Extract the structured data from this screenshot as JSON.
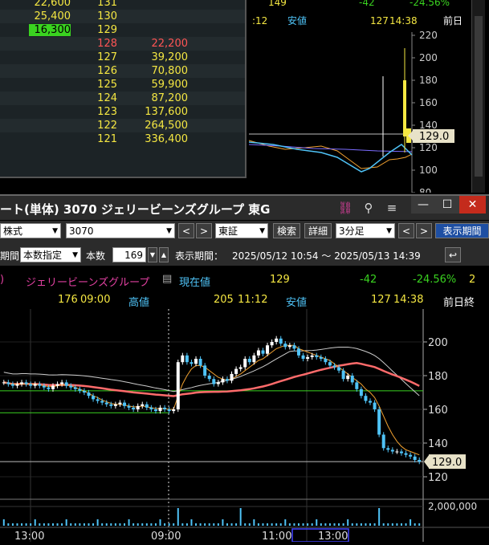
{
  "board": {
    "rows": [
      {
        "vol": "22,600",
        "price": "131",
        "bid": ""
      },
      {
        "vol": "25,400",
        "price": "130",
        "bid": ""
      },
      {
        "vol": "16,300",
        "price": "129",
        "bid": ""
      },
      {
        "vol": "",
        "price": "128",
        "bid": "22,200"
      },
      {
        "vol": "",
        "price": "127",
        "bid": "39,200"
      },
      {
        "vol": "",
        "price": "126",
        "bid": "70,800"
      },
      {
        "vol": "",
        "price": "125",
        "bid": "59,900"
      },
      {
        "vol": "",
        "price": "124",
        "bid": "87,200"
      },
      {
        "vol": "",
        "price": "123",
        "bid": "137,600"
      },
      {
        "vol": "",
        "price": "122",
        "bid": "264,500"
      },
      {
        "vol": "",
        "price": "121",
        "bid": "336,400"
      }
    ]
  },
  "mini": {
    "header_val": "149",
    "header_change": "-42",
    "header_pct": "-24.56%",
    "time_a": ":12",
    "low_label": "安値",
    "low_val": "127",
    "low_time": "14:38",
    "prev_label": "前日",
    "y_ticks": [
      "220",
      "200",
      "180",
      "160",
      "140",
      "120",
      "100",
      "80"
    ],
    "price_tag": "129.0"
  },
  "window": {
    "title": "ート(単体) 3070 ジェリービーンズグループ 東G",
    "link_badge": "4",
    "btn_min": "—",
    "btn_max": "☐",
    "btn_close": "✕"
  },
  "toolbar1": {
    "market_type": "株式",
    "code": "3070",
    "prev": "<",
    "next": ">",
    "exchange": "東証",
    "search": "検索",
    "detail": "詳細",
    "interval": "3分足",
    "prev2": "<",
    "next2": ">",
    "display_period": "表示期間"
  },
  "toolbar2": {
    "period_label": "期間",
    "period_mode": "本数指定",
    "count_label": "本数",
    "count_value": "169",
    "display_label": "表示期間：",
    "range": "2025/05/12 10:54 ～ 2025/05/13 14:39"
  },
  "info": {
    "name_prefix": ")",
    "name": "ジェリービーンズグループ",
    "current_label": "現在値",
    "current_value": "129",
    "change": "-42",
    "change_pct": "-24.56%",
    "trailing": "2",
    "open_val": "176",
    "open_time": "09:00",
    "high_label": "高値",
    "high_val": "205",
    "high_time": "11:12",
    "low_label": "安値",
    "low_val": "127",
    "low_time": "14:38",
    "prev_close_label": "前日終"
  },
  "colors": {
    "up": "#ffffff",
    "down": "#4fc3f7",
    "ma_short": "#f0a030",
    "ma_mid": "#ff6b6b",
    "ma_long": "#cccccc",
    "green_line": "#3ad320",
    "yellow": "#f5e742"
  },
  "chart_data": {
    "type": "candlestick",
    "y_ticks": [
      "200",
      "180",
      "160",
      "140",
      "120"
    ],
    "ylim": [
      110,
      210
    ],
    "volume_tick": "2,000,000",
    "x_ticks": [
      "13:00",
      "09:00",
      "11:00",
      "13:00"
    ],
    "price_tag": "129.0",
    "close_series": [
      176,
      175,
      174,
      175,
      176,
      175,
      174,
      175,
      174,
      173,
      172,
      174,
      175,
      176,
      174,
      173,
      172,
      171,
      170,
      168,
      166,
      165,
      164,
      163,
      162,
      163,
      164,
      162,
      161,
      160,
      162,
      163,
      161,
      160,
      159,
      161,
      160,
      159,
      160,
      188,
      192,
      188,
      187,
      190,
      186,
      180,
      178,
      175,
      176,
      178,
      177,
      181,
      184,
      185,
      190,
      188,
      192,
      195,
      193,
      198,
      200,
      202,
      199,
      197,
      198,
      196,
      192,
      190,
      191,
      192,
      191,
      190,
      188,
      186,
      185,
      183,
      178,
      180,
      176,
      172,
      168,
      165,
      164,
      160,
      145,
      137,
      136,
      135,
      135,
      134,
      133,
      132,
      130,
      129
    ],
    "ma_short": [
      176,
      175.5,
      175,
      175,
      175,
      175,
      175,
      175,
      174.5,
      174,
      173.5,
      173.5,
      174,
      174.5,
      174.5,
      174,
      173,
      172,
      171,
      169.5,
      168,
      167,
      165.5,
      164.5,
      163.5,
      163,
      163,
      162.5,
      162,
      161.5,
      161.5,
      162,
      161.5,
      161,
      160.5,
      160.5,
      160.5,
      160,
      160,
      168,
      175,
      180,
      184,
      186,
      186,
      185,
      183,
      181,
      179,
      178,
      177.5,
      178,
      179.5,
      181,
      183,
      185,
      187,
      189,
      190,
      192,
      194,
      196,
      197,
      198,
      198,
      198,
      196,
      195,
      194,
      193,
      192,
      191,
      190,
      189,
      187,
      185,
      183,
      181,
      179,
      177,
      175,
      172,
      170,
      167,
      162,
      156,
      150,
      145,
      141,
      138,
      136,
      135,
      134,
      133
    ]
  }
}
